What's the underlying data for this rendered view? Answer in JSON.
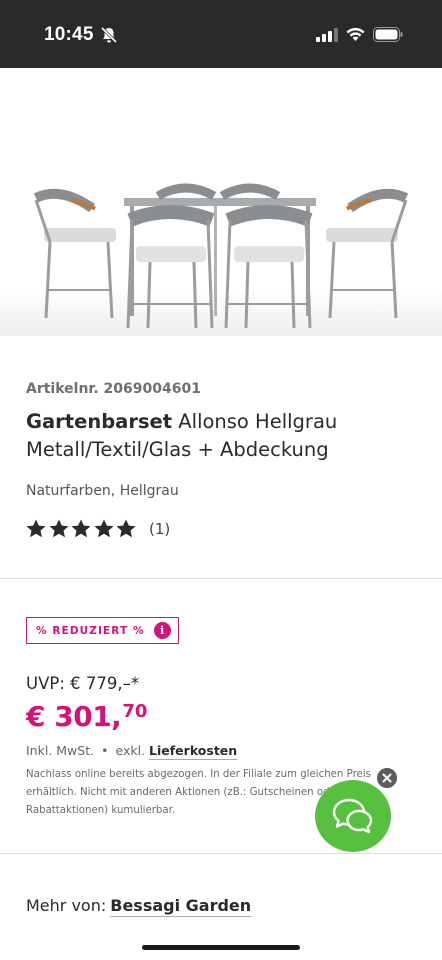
{
  "status_bar": {
    "time": "10:45",
    "icons": [
      "bell-slash-icon",
      "signal-icon",
      "wifi-icon",
      "battery-icon"
    ]
  },
  "product": {
    "image_alt": "Gartenbarset Allonso Hellgrau",
    "article_number": "Artikelnr. 2069004601",
    "title_bold": "Gartenbarset",
    "title_rest": " Allonso Hellgrau Metall/Textil/Glas + Abdeckung",
    "variant": "Naturfarben, Hellgrau",
    "rating": 5,
    "rating_count": "(1)"
  },
  "pricing": {
    "badge_label": "% REDUZIERT %",
    "badge_info": "i",
    "uvp": "UVP: € 779,–*",
    "price_main": "€ 301,",
    "price_cents": "70",
    "tax": "Inkl. MwSt.",
    "dot": "•",
    "shipping_prefix": "exkl.",
    "shipping_link": "Lieferkosten",
    "note": "Nachlass online bereits abgezogen. In der Filiale zum gleichen Preis erhältlich. Nicht mit anderen Aktionen (zB.: Gutscheinen oder Rabattaktionen) kumulierbar."
  },
  "more_from": {
    "label": "Mehr von:",
    "brand": "Bessagi Garden"
  },
  "colors": {
    "accent": "#d4127a",
    "chat": "#57c03e",
    "status_bar": "#2a2a2c"
  }
}
